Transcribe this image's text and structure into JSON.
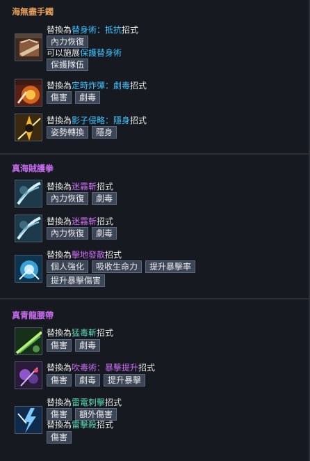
{
  "sections": [
    {
      "title": "海無盡手鐲",
      "entries": [
        {
          "icon": "ship-icon",
          "lines": [
            {
              "prefix": "替換為",
              "skill": "替身術：抵抗",
              "suffix": "招式",
              "tags": [
                "內力恢復"
              ]
            },
            {
              "prefix": "可以施展",
              "skill": "保護替身術",
              "suffix": "",
              "tags": [
                "保護隊伍"
              ]
            }
          ]
        },
        {
          "icon": "time-bomb-icon",
          "lines": [
            {
              "prefix": "替換為",
              "skill": "定時炸彈：劇毒",
              "suffix": "招式",
              "tags": [
                "傷害",
                "劇毒"
              ]
            }
          ]
        },
        {
          "icon": "shadow-strike-icon",
          "lines": [
            {
              "prefix": "替換為",
              "skill": "影子侵略：隱身",
              "suffix": "招式",
              "tags": [
                "姿勢轉換",
                "隱身"
              ]
            }
          ]
        }
      ]
    },
    {
      "title": "真海賊護拳",
      "entries": [
        {
          "icon": "mist-slash-icon",
          "lines": [
            {
              "prefix": "替換為",
              "skill": "迷霧斬",
              "suffix": "招式",
              "tags": [
                "內力恢復",
                "劇毒"
              ]
            }
          ]
        },
        {
          "icon": "mist-slash-icon",
          "lines": [
            {
              "prefix": "替換為",
              "skill": "迷霧斬",
              "suffix": "招式",
              "tags": [
                "內力恢復",
                "劇毒"
              ]
            }
          ]
        },
        {
          "icon": "ground-burst-icon",
          "lines": [
            {
              "prefix": "替換為",
              "skill": "擊地發散",
              "suffix": "招式",
              "tags": [
                "個人強化",
                "吸收生命力",
                "提升暴擊率",
                "提升暴擊傷害"
              ]
            }
          ]
        }
      ]
    },
    {
      "title": "真青龍腰帶",
      "entries": [
        {
          "icon": "fierce-poison-slash-icon",
          "lines": [
            {
              "prefix": "替換為",
              "skill": "猛毒斬",
              "suffix": "招式",
              "tags": [
                "傷害",
                "劇毒"
              ]
            }
          ]
        },
        {
          "icon": "poison-blow-icon",
          "lines": [
            {
              "prefix": "替換為",
              "skill": "吹毒術：暴擊提升",
              "suffix": "招式",
              "tags": [
                "傷害",
                "劇毒",
                "提升暴擊"
              ]
            }
          ]
        },
        {
          "icon": "thunder-stab-icon",
          "lines": [
            {
              "prefix": "替換為",
              "skill": "雷電刺擊",
              "suffix": "招式",
              "tags": [
                "傷害",
                "額外傷害"
              ]
            },
            {
              "prefix": "替換為",
              "skill": "雷擊殺",
              "suffix": "招式",
              "tags": [
                "傷害"
              ]
            }
          ]
        }
      ]
    }
  ]
}
